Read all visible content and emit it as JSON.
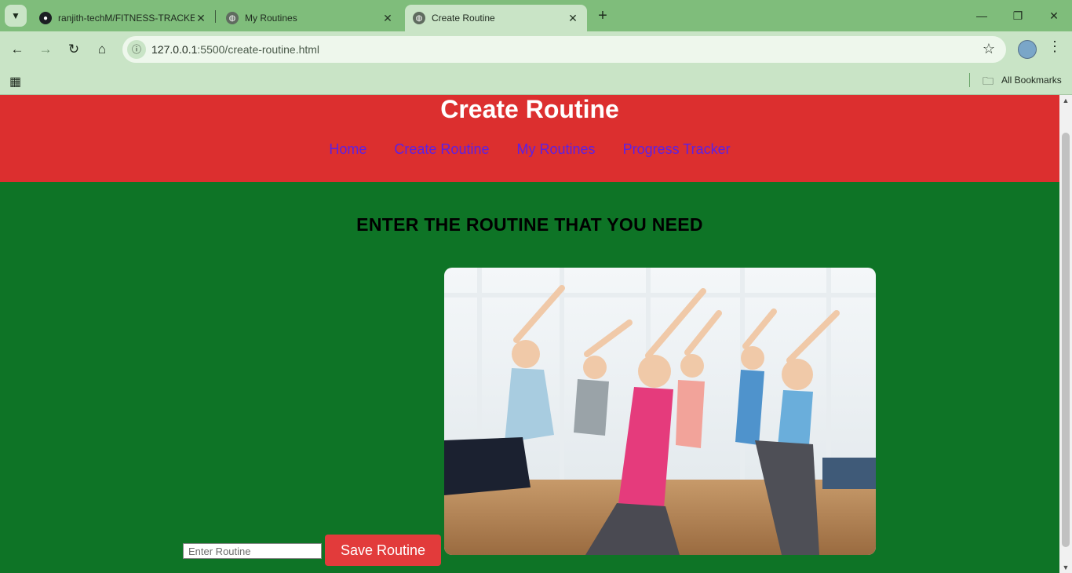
{
  "browser": {
    "tabs": [
      {
        "title": "ranjith-techM/FITNESS-TRACKE",
        "icon": "github-icon",
        "active": false
      },
      {
        "title": "My Routines",
        "icon": "globe-icon",
        "active": false
      },
      {
        "title": "Create Routine",
        "icon": "globe-icon",
        "active": true
      }
    ],
    "url_host": "127.0.0.1",
    "url_rest": ":5500/create-routine.html",
    "bookmarks_label": "All Bookmarks"
  },
  "page": {
    "title": "Create Routine",
    "nav": [
      "Home",
      "Create Routine",
      "My Routines",
      "Progress Tracker"
    ],
    "heading": "ENTER THE ROUTINE THAT YOU NEED",
    "image_alt": "group fitness class stretching",
    "input_placeholder": "Enter Routine",
    "input_value": "",
    "save_button": "Save Routine"
  },
  "colors": {
    "header_bg": "#dc2f2f",
    "page_bg": "#0e7426",
    "nav_link": "#5b21e6",
    "button_bg": "#e23b3b",
    "browser_frame": "#7fbd7b"
  }
}
